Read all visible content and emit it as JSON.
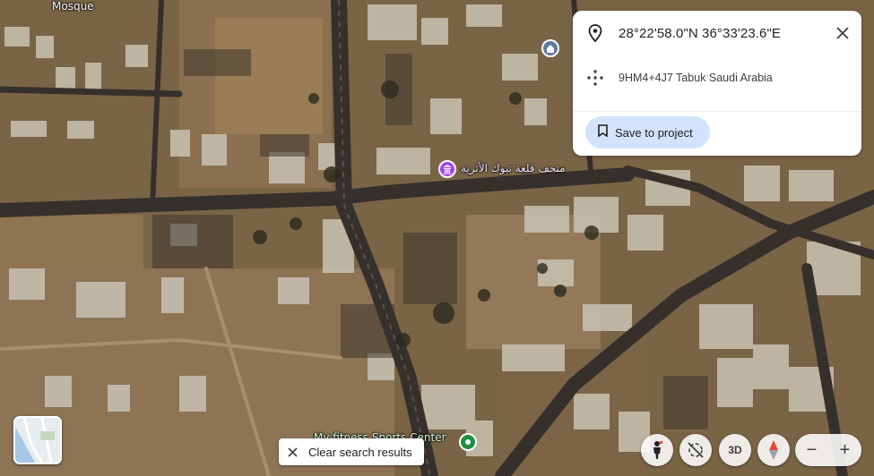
{
  "map": {
    "labels": {
      "mosque": "Mosque",
      "museum": "متحف قلعة تبوك الأثرية",
      "sports_center": "My fitness Sports Center"
    },
    "museum_pin_color": "#a142f4",
    "mosque_pin_color": "#5f7aa3",
    "sports_pin_color": "#1e8e3e"
  },
  "info_card": {
    "coordinates": "28°22'58.0\"N 36°33'23.6\"E",
    "plus_code": "9HM4+4J7 Tabuk Saudi Arabia",
    "save_label": "Save to project"
  },
  "controls": {
    "clear_search_label": "Clear search results",
    "btn_3d_label": "3D",
    "zoom_out": "−",
    "zoom_in": "+"
  },
  "icons": {
    "pin": "location-pin-icon",
    "plus_code": "plus-code-icon",
    "close": "close-icon",
    "bookmark": "bookmark-icon",
    "pegman": "pegman-icon",
    "tilt": "tilt-icon",
    "compass": "compass-icon"
  }
}
